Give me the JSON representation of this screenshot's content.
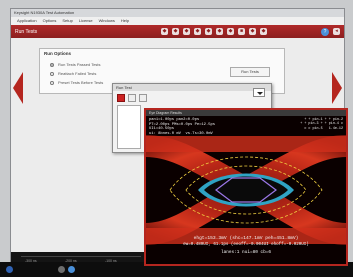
{
  "app": {
    "title": "Keysight N1930A Test Automation",
    "menu": [
      "Application",
      "Options",
      "Setup",
      "License",
      "Windows",
      "Help"
    ],
    "toolbar_title": "Run Tests",
    "toolbar_tools": [
      "◆",
      "◆",
      "◆",
      "◆",
      "◆",
      "◆",
      "◆",
      "■",
      "◆",
      "◆"
    ]
  },
  "run_panel": {
    "legend": "Run Options",
    "options": [
      {
        "label": "Run Tests Passed Tests",
        "selected": true
      },
      {
        "label": "Reattach Failed Tests",
        "selected": false
      },
      {
        "label": "Preset Tests Before Tests",
        "selected": false
      }
    ],
    "button": "Run Tests"
  },
  "run_dialog": {
    "title": "Run Test"
  },
  "eye_window": {
    "title": "Eye Diagram Results",
    "info_left": [
      "pan1=1.00ps pan2=0.0ps",
      "PT=2.00ps PMs=0.0ps Pe=12.5ps",
      "UI1=40.50ps",
      "ui: 8bnes.0 mV  vs.Ts=30.0mV"
    ],
    "info_right": [
      "+ + pin-1 + + pin-2",
      "+ + pin-3 + + pin-4 c",
      "c c pin-5   1.4e-12"
    ],
    "measure_lines": [
      "ehgt=153.3mV (shc=147.1mV peh=451.8mV)",
      "ew=0.489UI, 61.1ps (eeoff=-0.004UI ehoff=-0.020UI)",
      "lanes:1 nui=80 cb=6"
    ]
  },
  "bottom": {
    "axis_labels": [
      "-300 ns",
      "-200 ns",
      "-100 ns"
    ]
  },
  "colors": {
    "accent": "#b5261f",
    "eye_hot": "#e33020"
  }
}
